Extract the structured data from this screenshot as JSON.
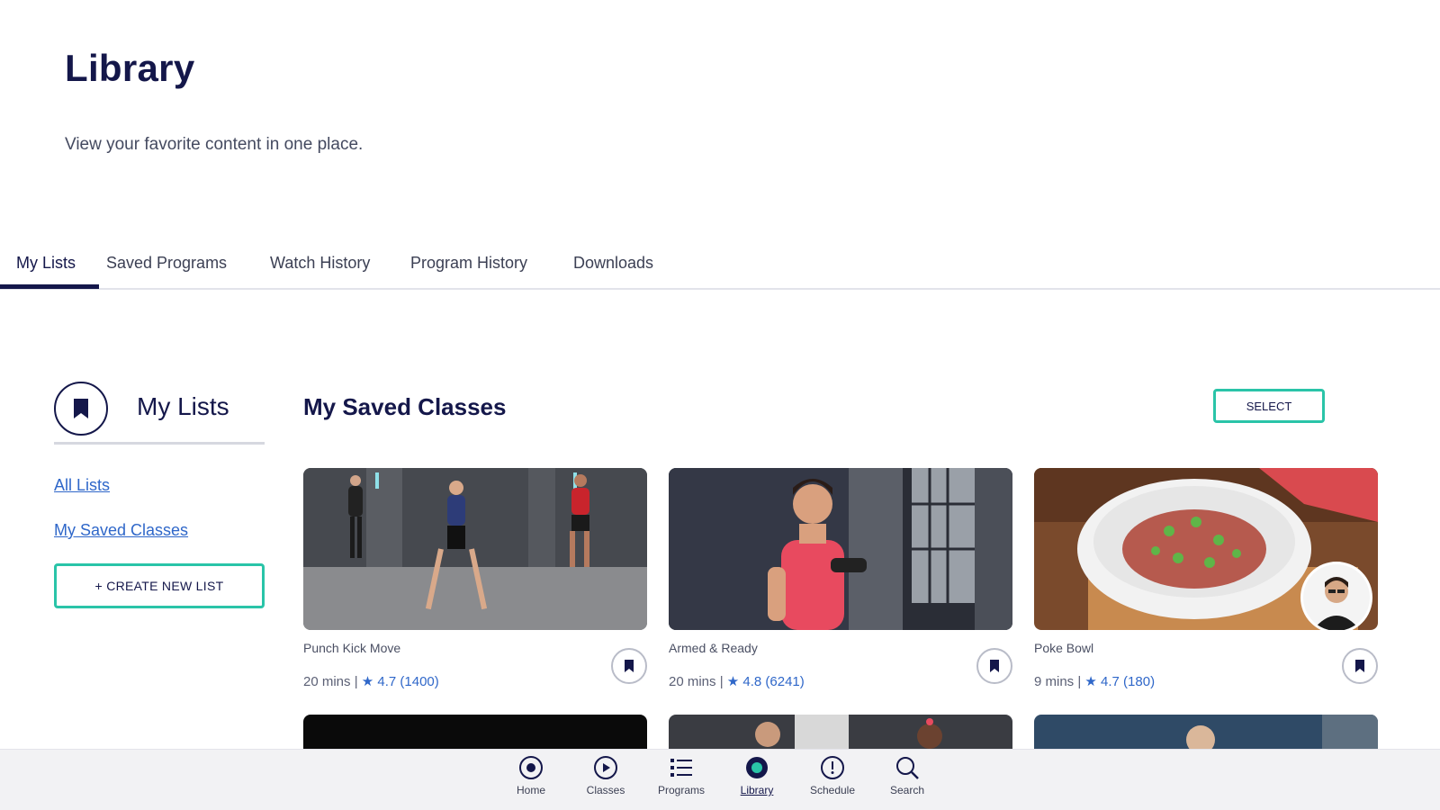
{
  "header": {
    "title": "Library",
    "subtitle": "View your favorite content in one place."
  },
  "tabs": [
    {
      "label": "My Lists",
      "active": true
    },
    {
      "label": "Saved Programs",
      "active": false
    },
    {
      "label": "Watch History",
      "active": false
    },
    {
      "label": "Program History",
      "active": false
    },
    {
      "label": "Downloads",
      "active": false
    }
  ],
  "sidebar": {
    "title": "My Lists",
    "icon": "bookmark-icon",
    "links": [
      "All Lists",
      "My Saved Classes"
    ],
    "create_label": "+ CREATE NEW LIST"
  },
  "main": {
    "section_title": "My Saved Classes",
    "select_label": "SELECT",
    "cards": [
      {
        "title": "Punch Kick Move",
        "duration": "20 mins |",
        "rating": "★ 4.7 (1400)"
      },
      {
        "title": "Armed & Ready",
        "duration": "20 mins |",
        "rating": "★ 4.8 (6241)"
      },
      {
        "title": "Poke Bowl",
        "duration": "9 mins |",
        "rating": "★ 4.7 (180)"
      }
    ]
  },
  "bottom_nav": [
    {
      "label": "Home",
      "icon": "home-icon",
      "active": false
    },
    {
      "label": "Classes",
      "icon": "play-icon",
      "active": false
    },
    {
      "label": "Programs",
      "icon": "list-icon",
      "active": false
    },
    {
      "label": "Library",
      "icon": "library-icon",
      "active": true
    },
    {
      "label": "Schedule",
      "icon": "schedule-icon",
      "active": false
    },
    {
      "label": "Search",
      "icon": "search-icon",
      "active": false
    }
  ],
  "colors": {
    "navy": "#14174a",
    "teal": "#2ac4a8",
    "link": "#2f67c9"
  }
}
